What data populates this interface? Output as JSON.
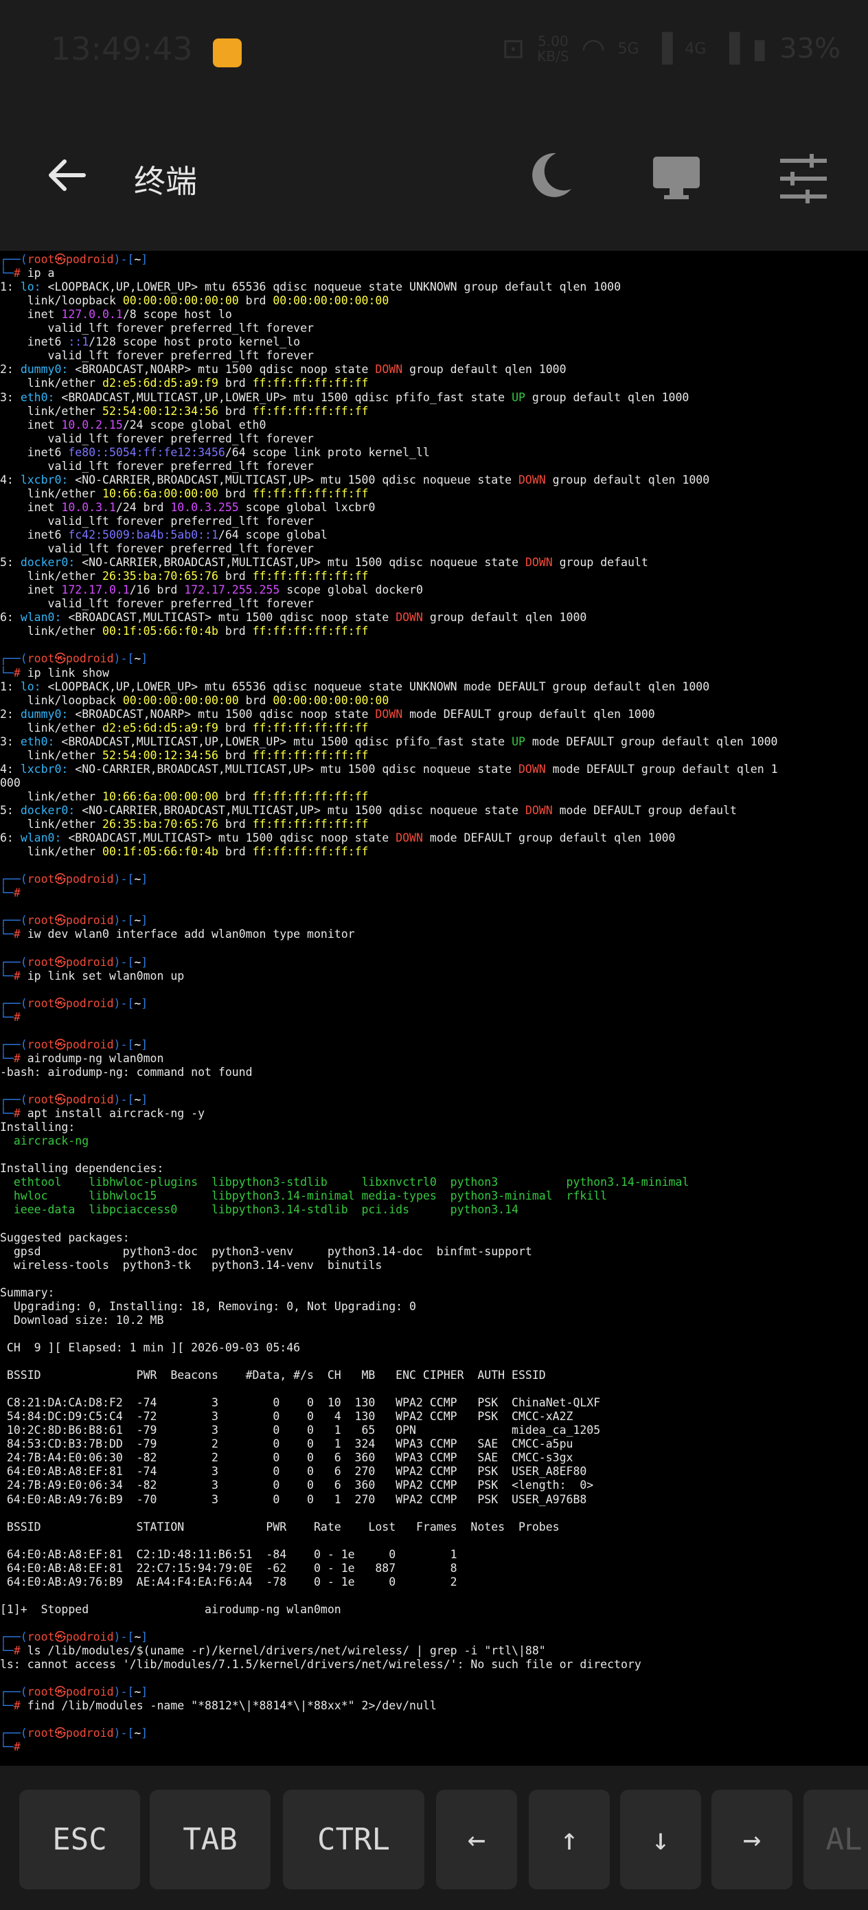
{
  "status_bar": {
    "time": "13:49:43",
    "net_speed_value": "5.00",
    "net_speed_unit": "KB/S",
    "signal_5g": "5G",
    "signal_4g": "4G",
    "battery": "33%"
  },
  "app_bar": {
    "title": "终端"
  },
  "terminal": [
    [
      {
        "t": "┌──(",
        "c": "blue"
      },
      {
        "t": "root㉿podroid",
        "c": "red"
      },
      {
        "t": ")-[",
        "c": "blue"
      },
      {
        "t": "~",
        "c": "white"
      },
      {
        "t": "]",
        "c": "blue"
      }
    ],
    [
      {
        "t": "└─",
        "c": "blue"
      },
      {
        "t": "# ",
        "c": "red"
      },
      {
        "t": "ip a"
      }
    ],
    [
      {
        "t": "1: "
      },
      {
        "t": "lo:",
        "c": "cyan"
      },
      {
        "t": " <LOOPBACK,UP,LOWER_UP> mtu 65536 qdisc noqueue state UNKNOWN group default qlen 1000"
      }
    ],
    [
      {
        "t": "    link/loopback "
      },
      {
        "t": "00:00:00:00:00:00",
        "c": "yellow"
      },
      {
        "t": " brd "
      },
      {
        "t": "00:00:00:00:00:00",
        "c": "yellow"
      }
    ],
    [
      {
        "t": "    inet "
      },
      {
        "t": "127.0.0.1",
        "c": "magenta"
      },
      {
        "t": "/8 scope host lo"
      }
    ],
    [
      {
        "t": "       valid_lft forever preferred_lft forever"
      }
    ],
    [
      {
        "t": "    inet6 "
      },
      {
        "t": "::1",
        "c": "violet"
      },
      {
        "t": "/128 scope host proto kernel_lo"
      }
    ],
    [
      {
        "t": "       valid_lft forever preferred_lft forever"
      }
    ],
    [
      {
        "t": "2: "
      },
      {
        "t": "dummy0:",
        "c": "cyan"
      },
      {
        "t": " <BROADCAST,NOARP> mtu 1500 qdisc noop state "
      },
      {
        "t": "DOWN",
        "c": "red"
      },
      {
        "t": " group default qlen 1000"
      }
    ],
    [
      {
        "t": "    link/ether "
      },
      {
        "t": "d2:e5:6d:d5:a9:f9",
        "c": "yellow"
      },
      {
        "t": " brd "
      },
      {
        "t": "ff:ff:ff:ff:ff:ff",
        "c": "yellow"
      }
    ],
    [
      {
        "t": "3: "
      },
      {
        "t": "eth0:",
        "c": "cyan"
      },
      {
        "t": " <BROADCAST,MULTICAST,UP,LOWER_UP> mtu 1500 qdisc pfifo_fast state "
      },
      {
        "t": "UP",
        "c": "green"
      },
      {
        "t": " group default qlen 1000"
      }
    ],
    [
      {
        "t": "    link/ether "
      },
      {
        "t": "52:54:00:12:34:56",
        "c": "yellow"
      },
      {
        "t": " brd "
      },
      {
        "t": "ff:ff:ff:ff:ff:ff",
        "c": "yellow"
      }
    ],
    [
      {
        "t": "    inet "
      },
      {
        "t": "10.0.2.15",
        "c": "magenta"
      },
      {
        "t": "/24 scope global eth0"
      }
    ],
    [
      {
        "t": "       valid_lft forever preferred_lft forever"
      }
    ],
    [
      {
        "t": "    inet6 "
      },
      {
        "t": "fe80::5054:ff:fe12:3456",
        "c": "violet"
      },
      {
        "t": "/64 scope link proto kernel_ll"
      }
    ],
    [
      {
        "t": "       valid_lft forever preferred_lft forever"
      }
    ],
    [
      {
        "t": "4: "
      },
      {
        "t": "lxcbr0:",
        "c": "cyan"
      },
      {
        "t": " <NO-CARRIER,BROADCAST,MULTICAST,UP> mtu 1500 qdisc noqueue state "
      },
      {
        "t": "DOWN",
        "c": "red"
      },
      {
        "t": " group default qlen 1000"
      }
    ],
    [
      {
        "t": "    link/ether "
      },
      {
        "t": "10:66:6a:00:00:00",
        "c": "yellow"
      },
      {
        "t": " brd "
      },
      {
        "t": "ff:ff:ff:ff:ff:ff",
        "c": "yellow"
      }
    ],
    [
      {
        "t": "    inet "
      },
      {
        "t": "10.0.3.1",
        "c": "magenta"
      },
      {
        "t": "/24 brd "
      },
      {
        "t": "10.0.3.255",
        "c": "magenta"
      },
      {
        "t": " scope global lxcbr0"
      }
    ],
    [
      {
        "t": "       valid_lft forever preferred_lft forever"
      }
    ],
    [
      {
        "t": "    inet6 "
      },
      {
        "t": "fc42:5009:ba4b:5ab0::1",
        "c": "violet"
      },
      {
        "t": "/64 scope global"
      }
    ],
    [
      {
        "t": "       valid_lft forever preferred_lft forever"
      }
    ],
    [
      {
        "t": "5: "
      },
      {
        "t": "docker0:",
        "c": "cyan"
      },
      {
        "t": " <NO-CARRIER,BROADCAST,MULTICAST,UP> mtu 1500 qdisc noqueue state "
      },
      {
        "t": "DOWN",
        "c": "red"
      },
      {
        "t": " group default"
      }
    ],
    [
      {
        "t": "    link/ether "
      },
      {
        "t": "26:35:ba:70:65:76",
        "c": "yellow"
      },
      {
        "t": " brd "
      },
      {
        "t": "ff:ff:ff:ff:ff:ff",
        "c": "yellow"
      }
    ],
    [
      {
        "t": "    inet "
      },
      {
        "t": "172.17.0.1",
        "c": "magenta"
      },
      {
        "t": "/16 brd "
      },
      {
        "t": "172.17.255.255",
        "c": "magenta"
      },
      {
        "t": " scope global docker0"
      }
    ],
    [
      {
        "t": "       valid_lft forever preferred_lft forever"
      }
    ],
    [
      {
        "t": "6: "
      },
      {
        "t": "wlan0:",
        "c": "cyan"
      },
      {
        "t": " <BROADCAST,MULTICAST> mtu 1500 qdisc noop state "
      },
      {
        "t": "DOWN",
        "c": "red"
      },
      {
        "t": " group default qlen 1000"
      }
    ],
    [
      {
        "t": "    link/ether "
      },
      {
        "t": "00:1f:05:66:f0:4b",
        "c": "yellow"
      },
      {
        "t": " brd "
      },
      {
        "t": "ff:ff:ff:ff:ff:ff",
        "c": "yellow"
      }
    ],
    [],
    [
      {
        "t": "┌──(",
        "c": "blue"
      },
      {
        "t": "root㉿podroid",
        "c": "red"
      },
      {
        "t": ")-[",
        "c": "blue"
      },
      {
        "t": "~",
        "c": "white"
      },
      {
        "t": "]",
        "c": "blue"
      }
    ],
    [
      {
        "t": "└─",
        "c": "blue"
      },
      {
        "t": "# ",
        "c": "red"
      },
      {
        "t": "ip link show"
      }
    ],
    [
      {
        "t": "1: "
      },
      {
        "t": "lo:",
        "c": "cyan"
      },
      {
        "t": " <LOOPBACK,UP,LOWER_UP> mtu 65536 qdisc noqueue state UNKNOWN mode DEFAULT group default qlen 1000"
      }
    ],
    [
      {
        "t": "    link/loopback "
      },
      {
        "t": "00:00:00:00:00:00",
        "c": "yellow"
      },
      {
        "t": " brd "
      },
      {
        "t": "00:00:00:00:00:00",
        "c": "yellow"
      }
    ],
    [
      {
        "t": "2: "
      },
      {
        "t": "dummy0:",
        "c": "cyan"
      },
      {
        "t": " <BROADCAST,NOARP> mtu 1500 qdisc noop state "
      },
      {
        "t": "DOWN",
        "c": "red"
      },
      {
        "t": " mode DEFAULT group default qlen 1000"
      }
    ],
    [
      {
        "t": "    link/ether "
      },
      {
        "t": "d2:e5:6d:d5:a9:f9",
        "c": "yellow"
      },
      {
        "t": " brd "
      },
      {
        "t": "ff:ff:ff:ff:ff:ff",
        "c": "yellow"
      }
    ],
    [
      {
        "t": "3: "
      },
      {
        "t": "eth0:",
        "c": "cyan"
      },
      {
        "t": " <BROADCAST,MULTICAST,UP,LOWER_UP> mtu 1500 qdisc pfifo_fast state "
      },
      {
        "t": "UP",
        "c": "green"
      },
      {
        "t": " mode DEFAULT group default qlen 1000"
      }
    ],
    [
      {
        "t": "    link/ether "
      },
      {
        "t": "52:54:00:12:34:56",
        "c": "yellow"
      },
      {
        "t": " brd "
      },
      {
        "t": "ff:ff:ff:ff:ff:ff",
        "c": "yellow"
      }
    ],
    [
      {
        "t": "4: "
      },
      {
        "t": "lxcbr0:",
        "c": "cyan"
      },
      {
        "t": " <NO-CARRIER,BROADCAST,MULTICAST,UP> mtu 1500 qdisc noqueue state "
      },
      {
        "t": "DOWN",
        "c": "red"
      },
      {
        "t": " mode DEFAULT group default qlen 1"
      }
    ],
    [
      {
        "t": "000"
      }
    ],
    [
      {
        "t": "    link/ether "
      },
      {
        "t": "10:66:6a:00:00:00",
        "c": "yellow"
      },
      {
        "t": " brd "
      },
      {
        "t": "ff:ff:ff:ff:ff:ff",
        "c": "yellow"
      }
    ],
    [
      {
        "t": "5: "
      },
      {
        "t": "docker0:",
        "c": "cyan"
      },
      {
        "t": " <NO-CARRIER,BROADCAST,MULTICAST,UP> mtu 1500 qdisc noqueue state "
      },
      {
        "t": "DOWN",
        "c": "red"
      },
      {
        "t": " mode DEFAULT group default"
      }
    ],
    [
      {
        "t": "    link/ether "
      },
      {
        "t": "26:35:ba:70:65:76",
        "c": "yellow"
      },
      {
        "t": " brd "
      },
      {
        "t": "ff:ff:ff:ff:ff:ff",
        "c": "yellow"
      }
    ],
    [
      {
        "t": "6: "
      },
      {
        "t": "wlan0:",
        "c": "cyan"
      },
      {
        "t": " <BROADCAST,MULTICAST> mtu 1500 qdisc noop state "
      },
      {
        "t": "DOWN",
        "c": "red"
      },
      {
        "t": " mode DEFAULT group default qlen 1000"
      }
    ],
    [
      {
        "t": "    link/ether "
      },
      {
        "t": "00:1f:05:66:f0:4b",
        "c": "yellow"
      },
      {
        "t": " brd "
      },
      {
        "t": "ff:ff:ff:ff:ff:ff",
        "c": "yellow"
      }
    ],
    [],
    [
      {
        "t": "┌──(",
        "c": "blue"
      },
      {
        "t": "root㉿podroid",
        "c": "red"
      },
      {
        "t": ")-[",
        "c": "blue"
      },
      {
        "t": "~",
        "c": "white"
      },
      {
        "t": "]",
        "c": "blue"
      }
    ],
    [
      {
        "t": "└─",
        "c": "blue"
      },
      {
        "t": "#",
        "c": "red"
      }
    ],
    [],
    [
      {
        "t": "┌──(",
        "c": "blue"
      },
      {
        "t": "root㉿podroid",
        "c": "red"
      },
      {
        "t": ")-[",
        "c": "blue"
      },
      {
        "t": "~",
        "c": "white"
      },
      {
        "t": "]",
        "c": "blue"
      }
    ],
    [
      {
        "t": "└─",
        "c": "blue"
      },
      {
        "t": "# ",
        "c": "red"
      },
      {
        "t": "iw dev wlan0 interface add wlan0mon type monitor"
      }
    ],
    [],
    [
      {
        "t": "┌──(",
        "c": "blue"
      },
      {
        "t": "root㉿podroid",
        "c": "red"
      },
      {
        "t": ")-[",
        "c": "blue"
      },
      {
        "t": "~",
        "c": "white"
      },
      {
        "t": "]",
        "c": "blue"
      }
    ],
    [
      {
        "t": "└─",
        "c": "blue"
      },
      {
        "t": "# ",
        "c": "red"
      },
      {
        "t": "ip link set wlan0mon up"
      }
    ],
    [],
    [
      {
        "t": "┌──(",
        "c": "blue"
      },
      {
        "t": "root㉿podroid",
        "c": "red"
      },
      {
        "t": ")-[",
        "c": "blue"
      },
      {
        "t": "~",
        "c": "white"
      },
      {
        "t": "]",
        "c": "blue"
      }
    ],
    [
      {
        "t": "└─",
        "c": "blue"
      },
      {
        "t": "#",
        "c": "red"
      }
    ],
    [],
    [
      {
        "t": "┌──(",
        "c": "blue"
      },
      {
        "t": "root㉿podroid",
        "c": "red"
      },
      {
        "t": ")-[",
        "c": "blue"
      },
      {
        "t": "~",
        "c": "white"
      },
      {
        "t": "]",
        "c": "blue"
      }
    ],
    [
      {
        "t": "└─",
        "c": "blue"
      },
      {
        "t": "# ",
        "c": "red"
      },
      {
        "t": "airodump-ng wlan0mon"
      }
    ],
    [
      {
        "t": "-bash: airodump-ng: command not found"
      }
    ],
    [],
    [
      {
        "t": "┌──(",
        "c": "blue"
      },
      {
        "t": "root㉿podroid",
        "c": "red"
      },
      {
        "t": ")-[",
        "c": "blue"
      },
      {
        "t": "~",
        "c": "white"
      },
      {
        "t": "]",
        "c": "blue"
      }
    ],
    [
      {
        "t": "└─",
        "c": "blue"
      },
      {
        "t": "# ",
        "c": "red"
      },
      {
        "t": "apt install aircrack-ng -y"
      }
    ],
    [
      {
        "t": "Installing:"
      }
    ],
    [
      {
        "t": "  aircrack-ng",
        "c": "green"
      }
    ],
    [],
    [
      {
        "t": "Installing dependencies:"
      }
    ],
    [
      {
        "t": "  ethtool    libhwloc-plugins  libpython3-stdlib     libxnvctrl0  python3          python3.14-minimal",
        "c": "green"
      }
    ],
    [
      {
        "t": "  hwloc      libhwloc15        libpython3.14-minimal media-types  python3-minimal  rfkill",
        "c": "green"
      }
    ],
    [
      {
        "t": "  ieee-data  libpciaccess0     libpython3.14-stdlib  pci.ids      python3.14",
        "c": "green"
      }
    ],
    [],
    [
      {
        "t": "Suggested packages:"
      }
    ],
    [
      {
        "t": "  gpsd            python3-doc  python3-venv     python3.14-doc  binfmt-support"
      }
    ],
    [
      {
        "t": "  wireless-tools  python3-tk   python3.14-venv  binutils"
      }
    ],
    [],
    [
      {
        "t": "Summary:"
      }
    ],
    [
      {
        "t": "  Upgrading: 0, Installing: 18, Removing: 0, Not Upgrading: 0"
      }
    ],
    [
      {
        "t": "  Download size: 10.2 MB"
      }
    ],
    [],
    [
      {
        "t": " CH  9 ][ Elapsed: 1 min ][ 2026-09-03 05:46"
      }
    ],
    [],
    [
      {
        "t": " BSSID              PWR  Beacons    #Data, #/s  CH   MB   ENC CIPHER  AUTH ESSID"
      }
    ],
    [],
    [
      {
        "t": " C8:21:DA:CA:D8:F2  -74        3        0    0  10  130   WPA2 CCMP   PSK  ChinaNet-QLXF"
      }
    ],
    [
      {
        "t": " 54:84:DC:D9:C5:C4  -72        3        0    0   4  130   WPA2 CCMP   PSK  CMCC-xA2Z"
      }
    ],
    [
      {
        "t": " 10:2C:8D:B6:B8:61  -79        3        0    0   1   65   OPN              midea_ca_1205"
      }
    ],
    [
      {
        "t": " 84:53:CD:B3:7B:DD  -79        2        0    0   1  324   WPA3 CCMP   SAE  CMCC-a5pu"
      }
    ],
    [
      {
        "t": " 24:7B:A4:E0:06:30  -82        2        0    0   6  360   WPA3 CCMP   SAE  CMCC-s3gx"
      }
    ],
    [
      {
        "t": " 64:E0:AB:A8:EF:81  -74        3        0    0   6  270   WPA2 CCMP   PSK  USER_A8EF80"
      }
    ],
    [
      {
        "t": " 24:7B:A9:E0:06:34  -82        3        0    0   6  360   WPA2 CCMP   PSK  <length:  0>"
      }
    ],
    [
      {
        "t": " 64:E0:AB:A9:76:B9  -70        3        0    0   1  270   WPA2 CCMP   PSK  USER_A976B8"
      }
    ],
    [],
    [
      {
        "t": " BSSID              STATION            PWR    Rate    Lost   Frames  Notes  Probes"
      }
    ],
    [],
    [
      {
        "t": " 64:E0:AB:A8:EF:81  C2:1D:48:11:B6:51  -84    0 - 1e     0        1"
      }
    ],
    [
      {
        "t": " 64:E0:AB:A8:EF:81  22:C7:15:94:79:0E  -62    0 - 1e   887        8"
      }
    ],
    [
      {
        "t": " 64:E0:AB:A9:76:B9  AE:A4:F4:EA:F6:A4  -78    0 - 1e     0        2"
      }
    ],
    [],
    [
      {
        "t": "[1]+  Stopped                 airodump-ng wlan0mon"
      }
    ],
    [],
    [
      {
        "t": "┌──(",
        "c": "blue"
      },
      {
        "t": "root㉿podroid",
        "c": "red"
      },
      {
        "t": ")-[",
        "c": "blue"
      },
      {
        "t": "~",
        "c": "white"
      },
      {
        "t": "]",
        "c": "blue"
      }
    ],
    [
      {
        "t": "└─",
        "c": "blue"
      },
      {
        "t": "# ",
        "c": "red"
      },
      {
        "t": "ls /lib/modules/$(uname -r)/kernel/drivers/net/wireless/ | grep -i \"rtl\\|88\""
      }
    ],
    [
      {
        "t": "ls: cannot access '/lib/modules/7.1.5/kernel/drivers/net/wireless/': No such file or directory"
      }
    ],
    [],
    [
      {
        "t": "┌──(",
        "c": "blue"
      },
      {
        "t": "root㉿podroid",
        "c": "red"
      },
      {
        "t": ")-[",
        "c": "blue"
      },
      {
        "t": "~",
        "c": "white"
      },
      {
        "t": "]",
        "c": "blue"
      }
    ],
    [
      {
        "t": "└─",
        "c": "blue"
      },
      {
        "t": "# ",
        "c": "red"
      },
      {
        "t": "find /lib/modules -name \"*8812*\\|*8814*\\|*88xx*\" 2>/dev/null"
      }
    ],
    [],
    [
      {
        "t": "┌──(",
        "c": "blue"
      },
      {
        "t": "root㉿podroid",
        "c": "red"
      },
      {
        "t": ")-[",
        "c": "blue"
      },
      {
        "t": "~",
        "c": "white"
      },
      {
        "t": "]",
        "c": "blue"
      }
    ],
    [
      {
        "t": "└─",
        "c": "blue"
      },
      {
        "t": "#",
        "c": "red"
      }
    ]
  ],
  "keys": [
    {
      "label": "ESC",
      "name": "esc-key"
    },
    {
      "label": "TAB",
      "name": "tab-key"
    },
    {
      "label": "CTRL",
      "name": "ctrl-key"
    },
    {
      "label": "←",
      "name": "arrow-left-key"
    },
    {
      "label": "↑",
      "name": "arrow-up-key"
    },
    {
      "label": "↓",
      "name": "arrow-down-key"
    },
    {
      "label": "→",
      "name": "arrow-right-key"
    },
    {
      "label": "AL",
      "name": "alt-key"
    }
  ]
}
